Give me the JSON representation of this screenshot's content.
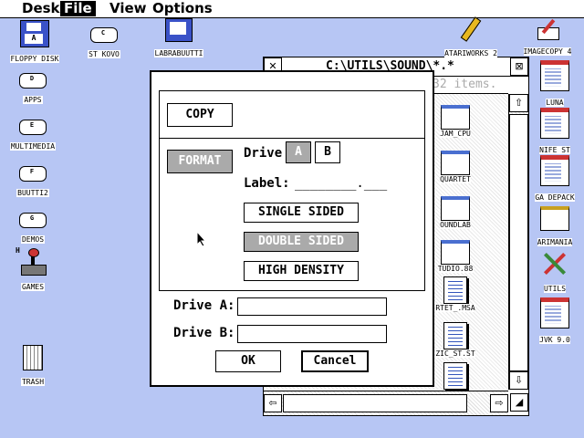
{
  "menubar": [
    "Desk",
    "File",
    "View",
    "Options"
  ],
  "desktop_left": [
    {
      "label": "FLOPPY DISK",
      "glyph": "A"
    },
    {
      "label": "ST KOVO",
      "glyph": "C"
    },
    {
      "label": "LABRABUUTTI",
      "glyph": ""
    },
    {
      "label": "APPS",
      "glyph": "D"
    },
    {
      "label": "MULTIMEDIA",
      "glyph": "E"
    },
    {
      "label": "BUUTTI2",
      "glyph": "F"
    },
    {
      "label": "DEMOS",
      "glyph": "G"
    },
    {
      "label": "GAMES",
      "glyph": "H"
    },
    {
      "label": "TRASH",
      "glyph": ""
    }
  ],
  "desktop_right": [
    "ATARIWORKS 2",
    "IMAGECOPY 4",
    "LUNA",
    "NIFE ST",
    "GA DEPACK",
    "ARIMANIA",
    "UTILS",
    "JVK 9.0"
  ],
  "window": {
    "title": "C:\\UTILS\\SOUND\\*.*",
    "info": "32 items.",
    "files": [
      "JAM_CPU",
      "QUARTET",
      "OUNDLAB",
      "TUDIO.88",
      "RTET_.MSA",
      "ZIC_ST.ST"
    ]
  },
  "dialog": {
    "copy": "COPY",
    "format": "FORMAT",
    "drive_label": "Drive",
    "drive_a": "A",
    "drive_b": "B",
    "label_label": "Label:",
    "label_value": "________.___",
    "single": "SINGLE SIDED",
    "double": "DOUBLE SIDED",
    "high": "HIGH DENSITY",
    "drive_a_label": "Drive A:",
    "drive_b_label": "Drive B:",
    "ok": "OK",
    "cancel": "Cancel"
  }
}
